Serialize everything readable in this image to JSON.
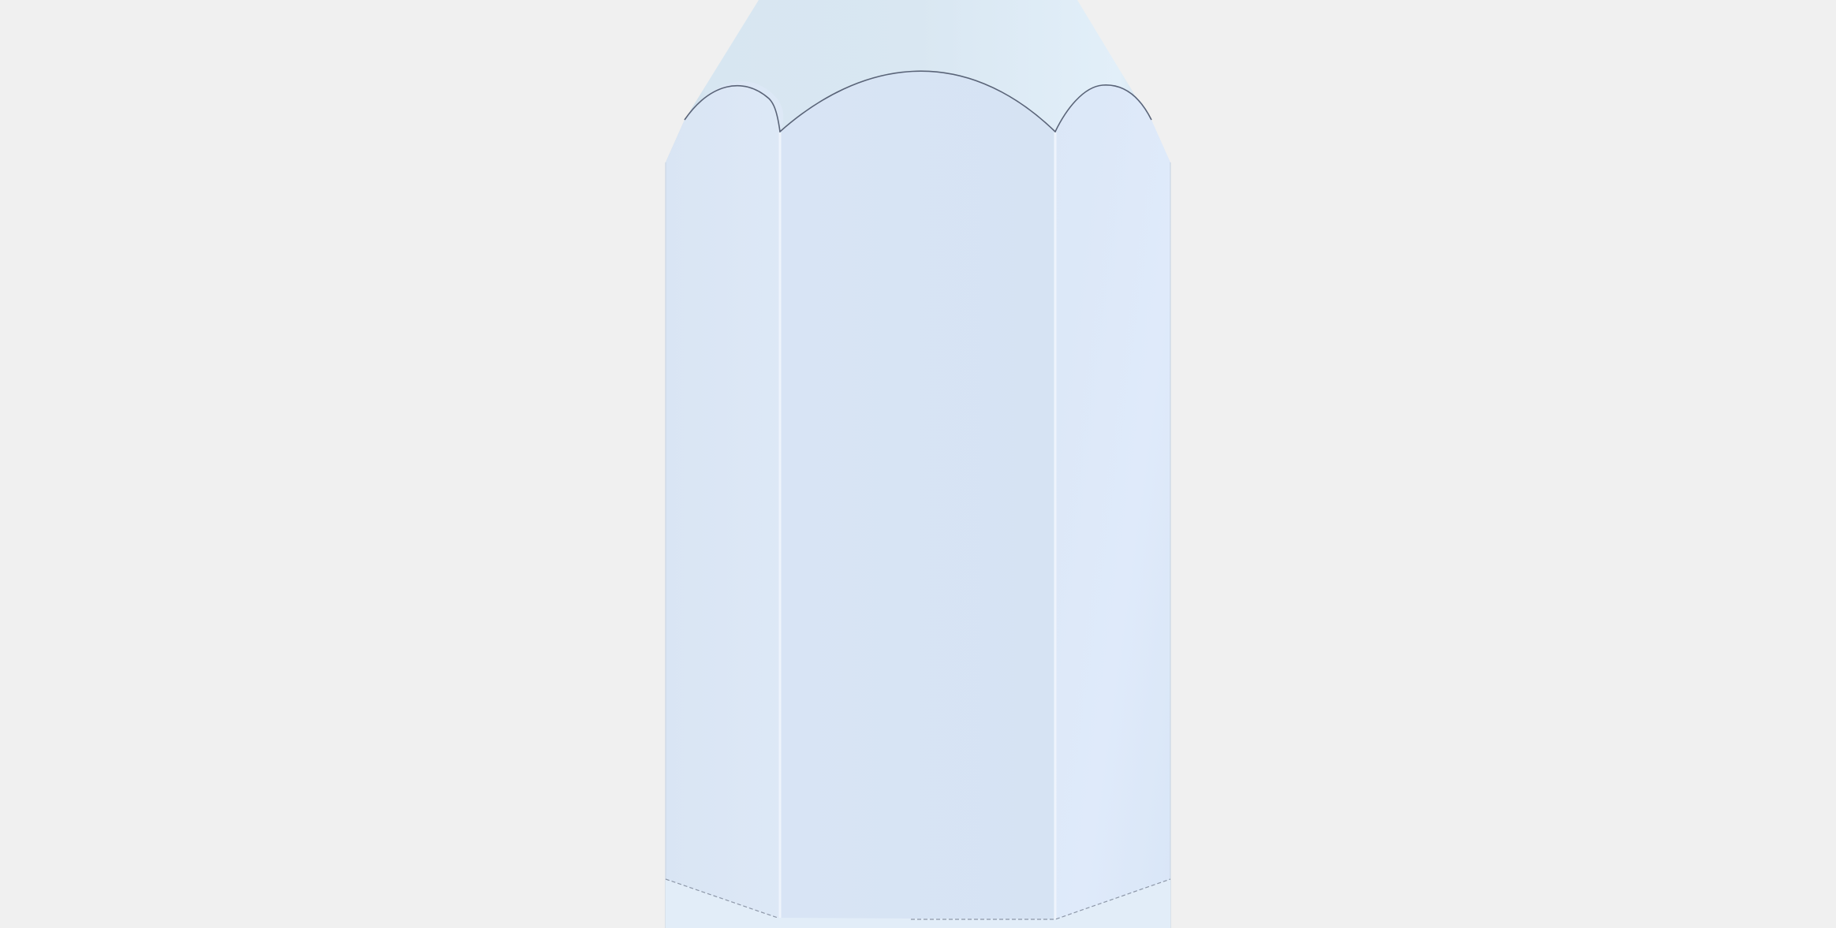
{
  "scene": {
    "background_color": "#f0f0f0",
    "subject": "pencil-icon",
    "colors": {
      "body_left_facet": "#dbe6f5",
      "body_center_facet": "#d6e3f4",
      "body_right_facet": "#dce8f8",
      "tip": "#dceaf5",
      "tip_shadow": "#b8cbd6",
      "edge_line": "#5a6478",
      "facet_divider": "#eef4fc",
      "base": "#e2edf8"
    }
  }
}
